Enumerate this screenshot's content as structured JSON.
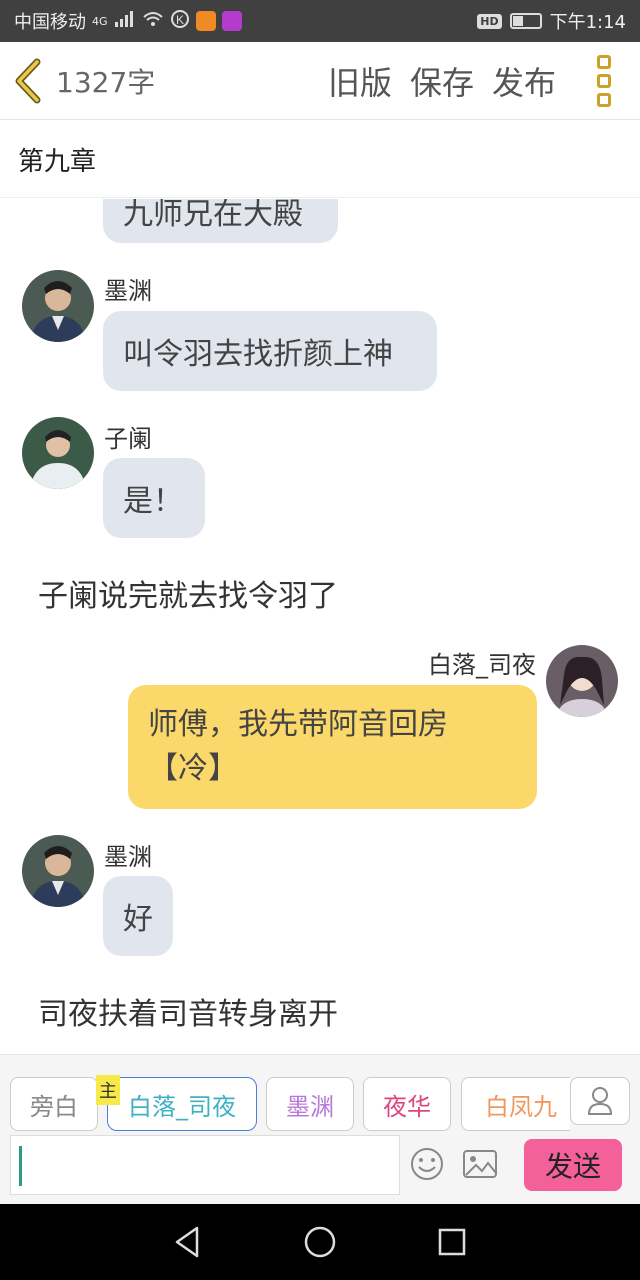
{
  "status": {
    "carrier": "中国移动",
    "network": "4G",
    "time": "下午1:14",
    "hd": "HD"
  },
  "header": {
    "word_count": "1327字",
    "old_version": "旧版",
    "save": "保存",
    "publish": "发布"
  },
  "chapter": {
    "title": "第九章"
  },
  "messages": {
    "m0": {
      "text": "九师兄在大殿"
    },
    "m1": {
      "name": "墨渊",
      "text": "叫令羽去找折颜上神"
    },
    "m2": {
      "name": "子阑",
      "text": "是！"
    },
    "n1": {
      "text": "子阑说完就去找令羽了"
    },
    "m3": {
      "name": "白落_司夜",
      "text": "师傅，我先带阿音回房【冷】"
    },
    "m4": {
      "name": "墨渊",
      "text": "好"
    },
    "n2": {
      "text": "司夜扶着司音转身离开"
    }
  },
  "roles": [
    "旁白",
    "白落_司夜",
    "墨渊",
    "夜华",
    "白凤九"
  ],
  "role_colors": [
    "#888888",
    "#3fb2c2",
    "#b77bd6",
    "#e0457f",
    "#f09860"
  ],
  "main_badge": "主",
  "composer": {
    "input_value": "",
    "send": "发送"
  },
  "colors": {
    "accent": "#c9a227",
    "send": "#f4609a",
    "bubble_self": "#fbd86a",
    "bubble_other": "#e1e6ee"
  },
  "icons": [
    "back-chevron-icon",
    "more-icon",
    "emoji-icon",
    "image-icon",
    "profile-icon",
    "nav-back-icon",
    "nav-home-icon",
    "nav-recent-icon"
  ]
}
